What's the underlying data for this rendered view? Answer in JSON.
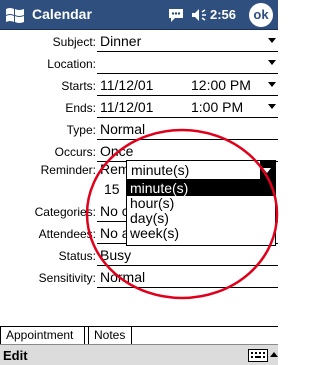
{
  "titlebar": {
    "title": "Calendar",
    "time": "2:56",
    "ok_label": "ok"
  },
  "form": {
    "subject": {
      "label": "Subject:",
      "value": "Dinner"
    },
    "location": {
      "label": "Location:",
      "value": ""
    },
    "starts": {
      "label": "Starts:",
      "date": "11/12/01",
      "time": "12:00 PM"
    },
    "ends": {
      "label": "Ends:",
      "date": "11/12/01",
      "time": "1:00 PM"
    },
    "type": {
      "label": "Type:",
      "value": "Normal"
    },
    "occurs": {
      "label": "Occurs:",
      "value": "Once"
    },
    "reminder": {
      "label": "Reminder:",
      "value": "Remind me",
      "amount": "15"
    },
    "categories": {
      "label": "Categories:",
      "value": "No c"
    },
    "attendees": {
      "label": "Attendees:",
      "value": "No a"
    },
    "status": {
      "label": "Status:",
      "value": "Busy"
    },
    "sensitivity": {
      "label": "Sensitivity:",
      "value": "Normal"
    }
  },
  "reminder_unit": {
    "selected": "minute(s)",
    "options": [
      "minute(s)",
      "hour(s)",
      "day(s)",
      "week(s)"
    ]
  },
  "tabs": {
    "appointment": "Appointment",
    "notes": "Notes"
  },
  "menubar": {
    "edit": "Edit"
  },
  "colors": {
    "titlebar": "#2f4f7f",
    "highlight": "#e0001b"
  }
}
